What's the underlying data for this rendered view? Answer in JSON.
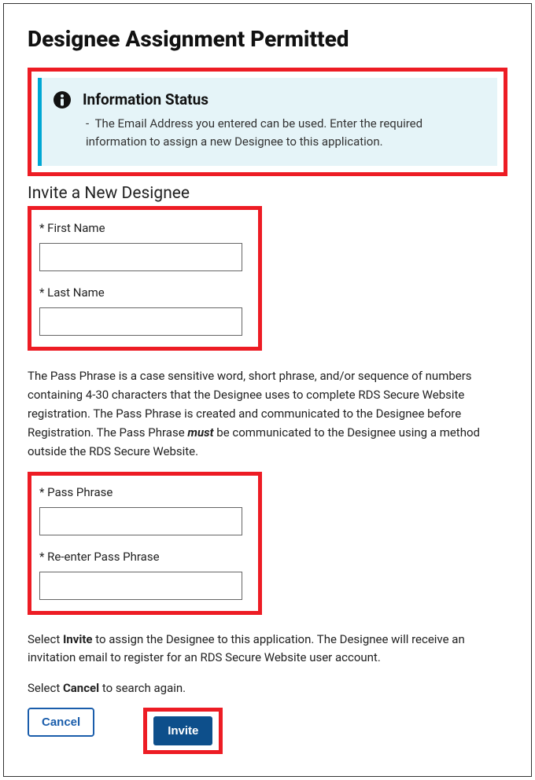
{
  "page_title": "Designee Assignment Permitted",
  "info": {
    "title": "Information Status",
    "dash": "-",
    "message": "The Email Address you entered can be used. Enter the required information to assign a new Designee to this application."
  },
  "section_title": "Invite a New Designee",
  "fields": {
    "first_name_label": "* First Name",
    "first_name_value": "",
    "last_name_label": "* Last Name",
    "last_name_value": "",
    "pass_label": "* Pass Phrase",
    "pass_value": "",
    "pass2_label": "* Re-enter Pass Phrase",
    "pass2_value": ""
  },
  "passphrase_desc_pre": "The Pass Phrase is a case sensitive word, short phrase, and/or sequence of numbers containing 4-30 characters that the Designee uses to complete RDS Secure Website registration. The Pass Phrase is created and communicated to the Designee before Registration. The Pass Phrase ",
  "passphrase_desc_em": "must",
  "passphrase_desc_post": " be communicated to the Designee using a method outside the RDS Secure Website.",
  "instr1_pre": "Select ",
  "instr1_strong": "Invite",
  "instr1_post": " to assign the Designee to this application. The Designee will receive an invitation email to register for an RDS Secure Website user account.",
  "instr2_pre": "Select ",
  "instr2_strong": "Cancel",
  "instr2_post": " to search again.",
  "buttons": {
    "cancel": "Cancel",
    "invite": "Invite"
  }
}
